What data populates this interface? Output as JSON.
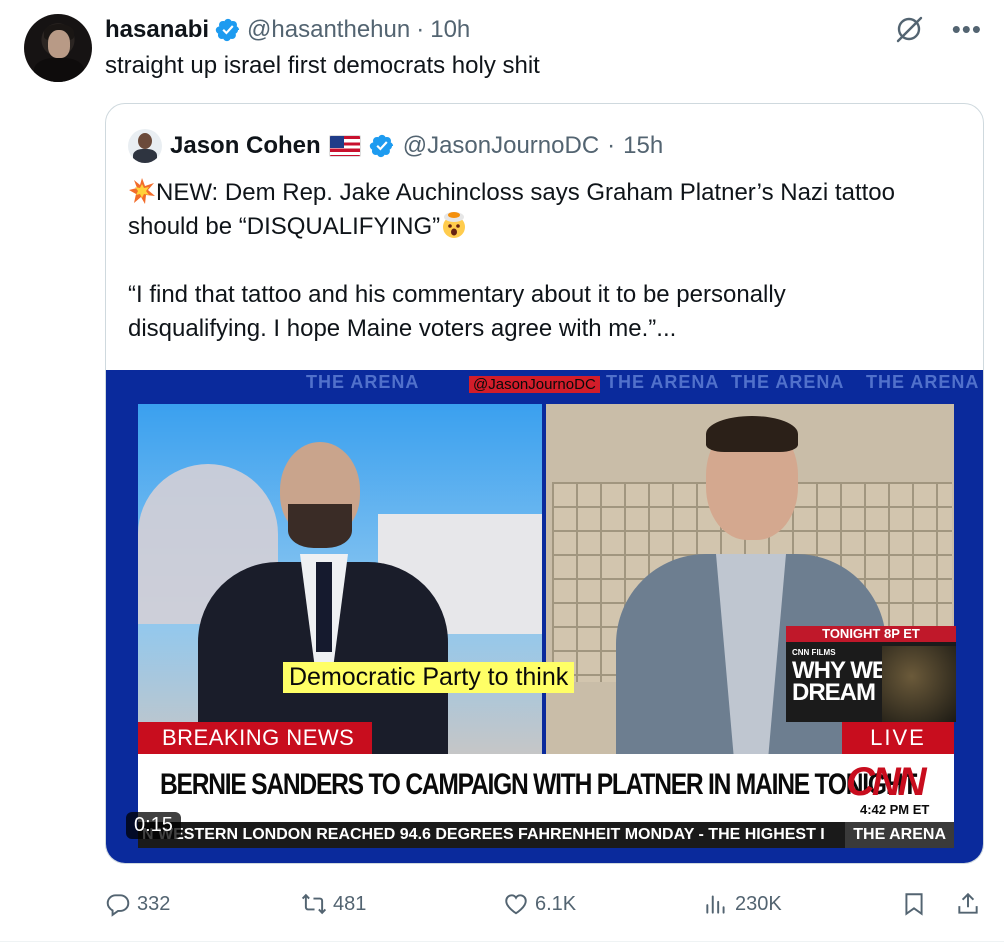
{
  "tweet": {
    "author_name": "hasanabi",
    "author_handle": "@hasanthehun",
    "separator": "·",
    "time": "10h",
    "text": "straight up israel first democrats holy shit"
  },
  "quote": {
    "author_name": "Jason Cohen",
    "author_handle": "@JasonJournoDC",
    "separator": "·",
    "time": "15h",
    "line1": "NEW: Dem Rep. Jake Auchincloss says Graham Platner’s Nazi tattoo",
    "line2": "should be “DISQUALIFYING”",
    "line3": "“I find that tattoo and his commentary about it to be personally",
    "line4": "disqualifying. I hope Maine voters agree with me.”..."
  },
  "video": {
    "watermark": "@JasonJournoDC",
    "caption": "Democratic Party to think",
    "bg_label_1": "THE ARENA",
    "bg_label_2": "THE ARENA",
    "bg_label_3": "THE ARENA",
    "bg_label_4": "THE ARENA",
    "promo_header": "TONIGHT 8P ET",
    "promo_network": "CNN FILMS",
    "promo_title_1": "WHY WE",
    "promo_title_2": "DREAM",
    "breaking": "BREAKING NEWS",
    "live": "LIVE",
    "headline": "BERNIE SANDERS TO CAMPAIGN WITH PLATNER IN MAINE TONIGHT",
    "network_logo": "CNN",
    "clock": "4:42 PM ET",
    "ticker": "N WESTERN LONDON REACHED 94.6 DEGREES FAHRENHEIT MONDAY - THE HIGHEST I",
    "ticker_tag": "THE ARENA",
    "duration": "0:15"
  },
  "actions": {
    "replies": "332",
    "reposts": "481",
    "likes": "6.1K",
    "views": "230K"
  },
  "icons": {
    "verified": "verified-badge-icon",
    "grok": "grok-icon",
    "more": "more-icon",
    "reply": "reply-icon",
    "repost": "repost-icon",
    "like": "like-icon",
    "views": "views-icon",
    "bookmark": "bookmark-icon",
    "share": "share-icon"
  },
  "colors": {
    "accent": "#1d9bf0",
    "secondary_text": "#536471",
    "cnn_red": "#c80d1e"
  }
}
